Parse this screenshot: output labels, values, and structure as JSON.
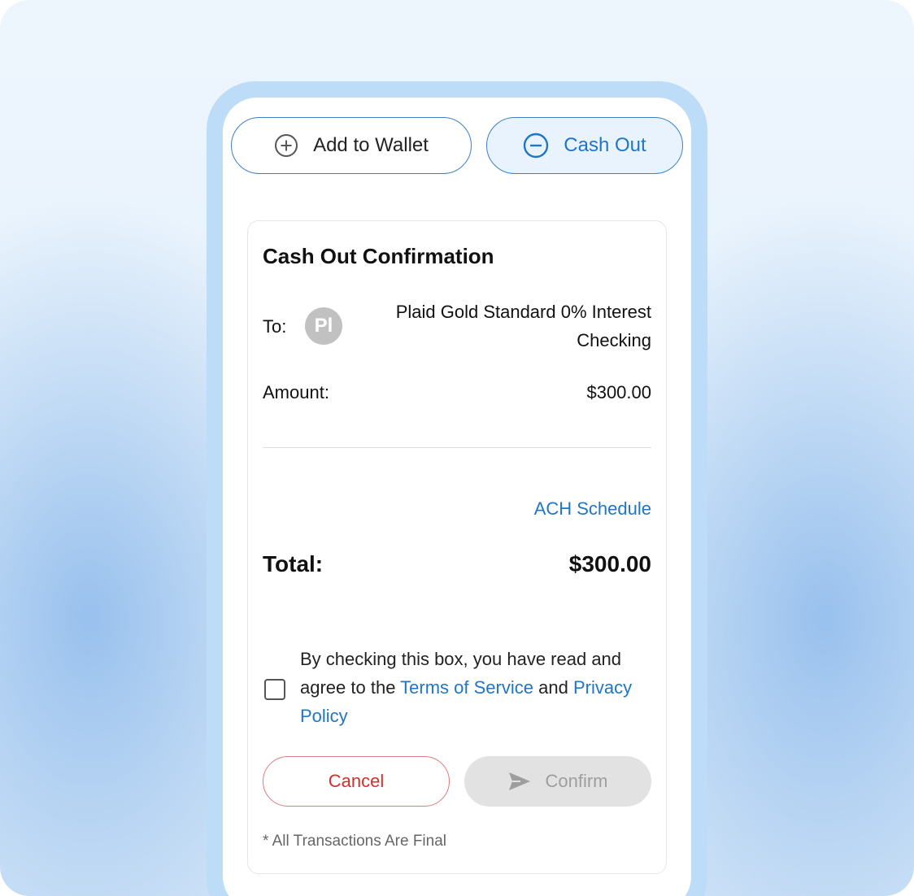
{
  "colors": {
    "accent": "#1f76c6",
    "cancel": "#d32f2f",
    "disabled": "#e2e2e2",
    "frame": "#bcdcf8"
  },
  "tabs": {
    "add": {
      "label": "Add to Wallet",
      "icon": "plus-circle-icon"
    },
    "cash_out": {
      "label": "Cash Out",
      "icon": "minus-circle-icon"
    }
  },
  "confirmation": {
    "title": "Cash Out Confirmation",
    "to_label": "To:",
    "avatar_initials": "Pl",
    "to_account": "Plaid Gold Standard 0% Interest Checking",
    "amount_label": "Amount:",
    "amount_value": "$300.00",
    "ach_link": "ACH Schedule",
    "total_label": "Total:",
    "total_value": "$300.00"
  },
  "consent": {
    "text_before": "By checking this box, you have read and agree to the",
    "terms_link": "Terms of Service",
    "text_mid": "and",
    "privacy_link": "Privacy Policy",
    "checked": false
  },
  "actions": {
    "cancel_label": "Cancel",
    "confirm_label": "Confirm",
    "confirm_icon": "send-icon"
  },
  "footnote": "* All Transactions Are Final"
}
